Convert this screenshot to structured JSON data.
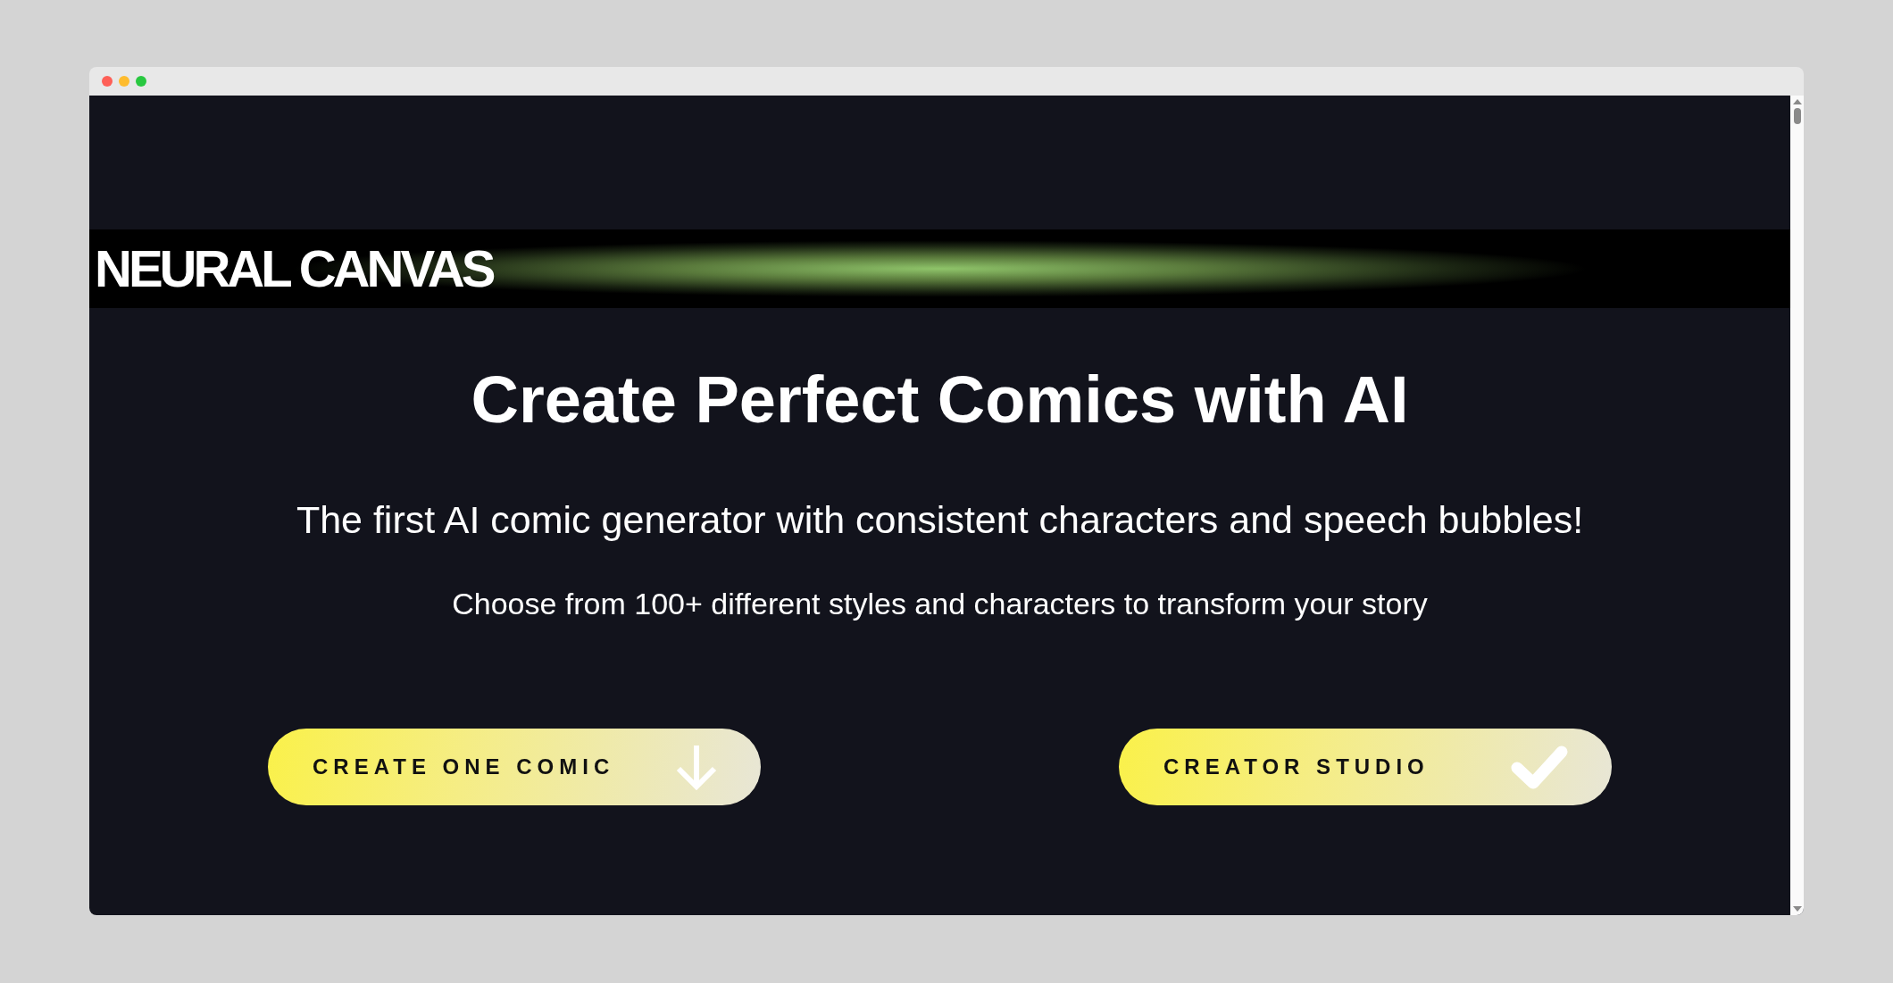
{
  "logo": "NEURAL CANVAS",
  "headline": "Create Perfect Comics with AI",
  "subtitle": "The first AI comic generator with consistent characters and speech bubbles!",
  "tagline": "Choose from 100+ different styles and characters to transform your story",
  "buttons": [
    {
      "label": "CREATE ONE COMIC",
      "kind": "download"
    },
    {
      "label": "CREATOR STUDIO",
      "kind": "confirm"
    }
  ]
}
